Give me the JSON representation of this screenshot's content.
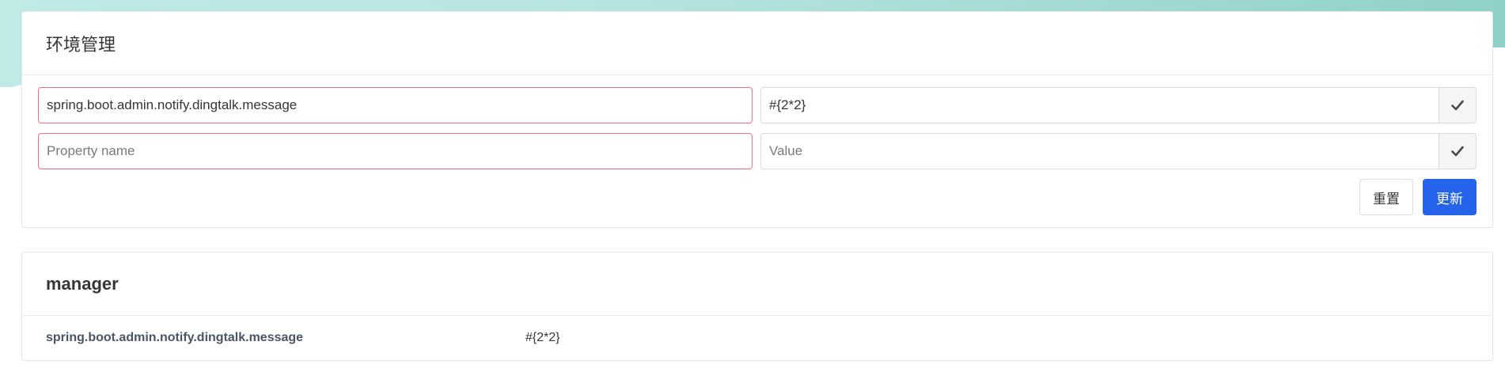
{
  "env_card": {
    "title": "环境管理",
    "rows": [
      {
        "name_value": "spring.boot.admin.notify.dingtalk.message",
        "name_placeholder": "Property name",
        "value_value": "#{2*2}",
        "value_placeholder": "Value",
        "check_icon": "check-icon"
      },
      {
        "name_value": "",
        "name_placeholder": "Property name",
        "value_value": "",
        "value_placeholder": "Value",
        "check_icon": "check-icon"
      }
    ],
    "reset_label": "重置",
    "update_label": "更新"
  },
  "manager_card": {
    "title": "manager",
    "properties": [
      {
        "key": "spring.boot.admin.notify.dingtalk.message",
        "value": "#{2*2}"
      }
    ]
  },
  "colors": {
    "primary": "#2563eb",
    "invalid_border": "#f2707e",
    "background_wave": "#a9dcd6"
  }
}
